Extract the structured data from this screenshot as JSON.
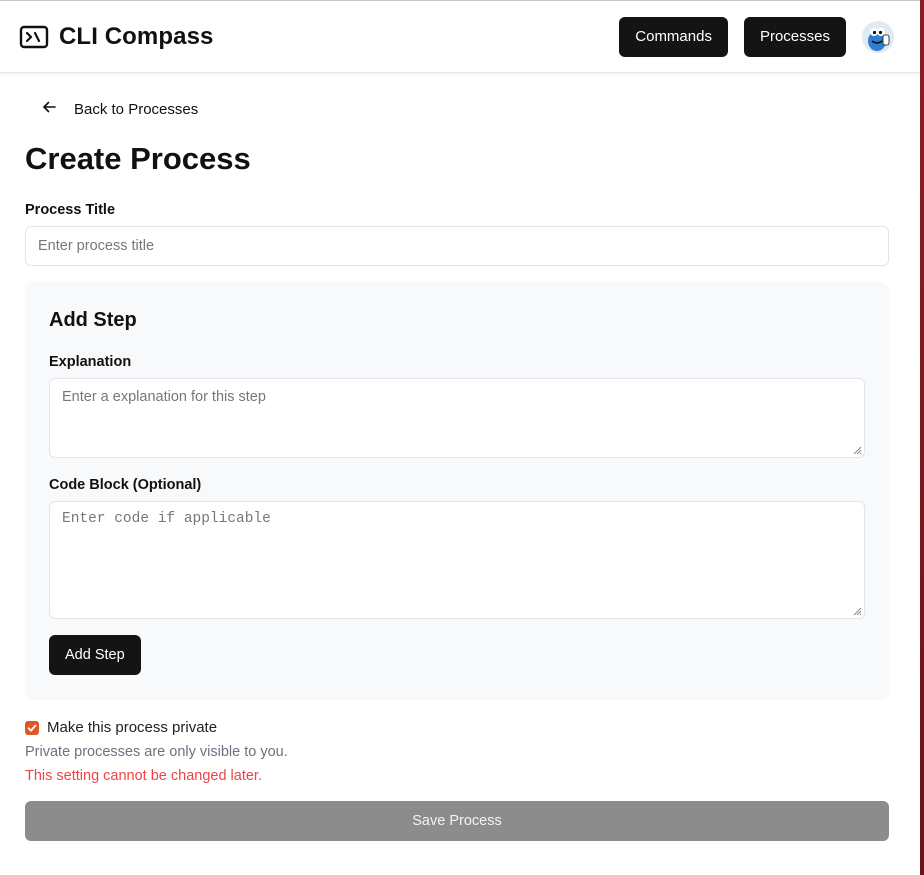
{
  "app": {
    "title": "CLI Compass",
    "logo_icon": "terminal-icon"
  },
  "nav": {
    "commands_label": "Commands",
    "processes_label": "Processes",
    "avatar_icon": "user-avatar"
  },
  "back_link": {
    "icon": "arrow-left-icon",
    "label": "Back to Processes"
  },
  "page": {
    "title": "Create Process"
  },
  "form": {
    "process_title_label": "Process Title",
    "process_title_placeholder": "Enter process title",
    "process_title_value": ""
  },
  "step": {
    "heading": "Add Step",
    "explanation_label": "Explanation",
    "explanation_placeholder": "Enter a explanation for this step",
    "code_label": "Code Block (Optional)",
    "code_placeholder": "Enter code if applicable",
    "add_button": "Add Step"
  },
  "privacy": {
    "checkbox_label": "Make this process private",
    "checked": true,
    "hint": "Private processes are only visible to you.",
    "warning": "This setting cannot be changed later."
  },
  "save_button": "Save Process",
  "colors": {
    "primary_button": "#141414",
    "checkbox_accent": "#e0582a",
    "warning_text": "#ef4444",
    "disabled_button": "#8c8c8c",
    "card_background": "#f8f9fa"
  }
}
